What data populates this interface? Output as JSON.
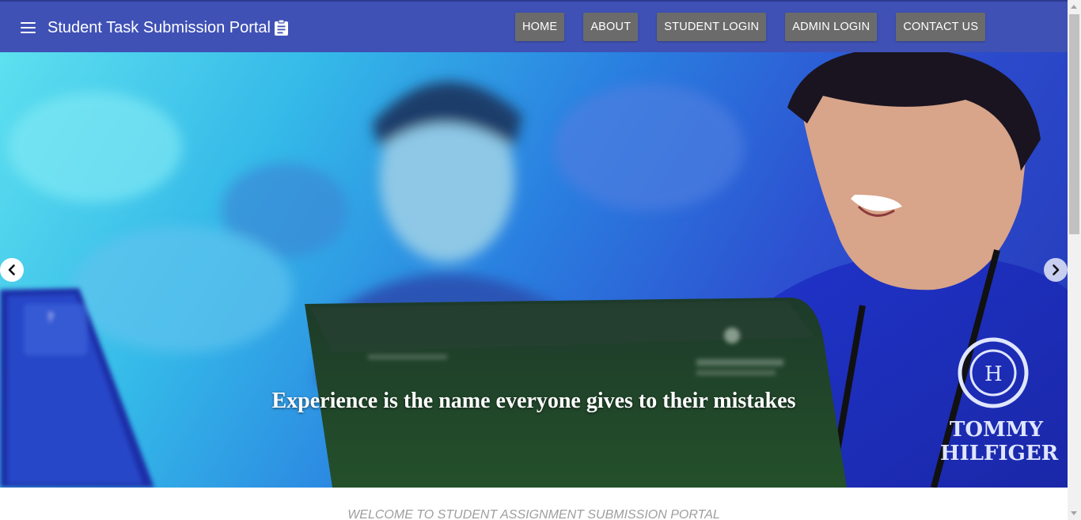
{
  "navbar": {
    "brand": "Student Task Submission Portal",
    "brand_icon": "clipboard-icon",
    "menu_icon": "hamburger-menu-icon",
    "background_color": "#3f51b5",
    "links": [
      {
        "label": "HOME",
        "key": "home"
      },
      {
        "label": "ABOUT",
        "key": "about"
      },
      {
        "label": "STUDENT LOGIN",
        "key": "student-login"
      },
      {
        "label": "ADMIN LOGIN",
        "key": "admin-login"
      },
      {
        "label": "CONTACT US",
        "key": "contact-us"
      }
    ]
  },
  "carousel": {
    "caption": "Experience is the name everyone gives to their mistakes",
    "prev_icon": "chevron-left-icon",
    "next_icon": "chevron-right-icon",
    "image_text": {
      "shirt_brand_line1": "TOMMY",
      "shirt_brand_line2": "HILFIGER"
    }
  },
  "welcome": {
    "text": "WELCOME TO STUDENT ASSIGNMENT SUBMISSION PORTAL"
  }
}
